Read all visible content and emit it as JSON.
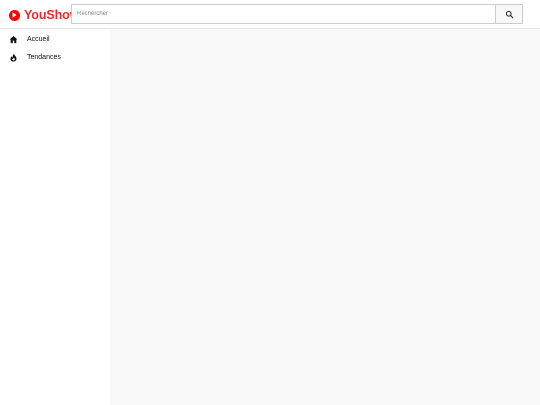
{
  "header": {
    "logo_text": "YouShow",
    "brand_color": "#e52d27",
    "search": {
      "placeholder": "Rechercher",
      "value": "",
      "button_icon": "search-icon"
    }
  },
  "sidebar": {
    "items": [
      {
        "label": "Accueil",
        "icon": "home-icon"
      },
      {
        "label": "Tendances",
        "icon": "flame-icon"
      }
    ]
  }
}
